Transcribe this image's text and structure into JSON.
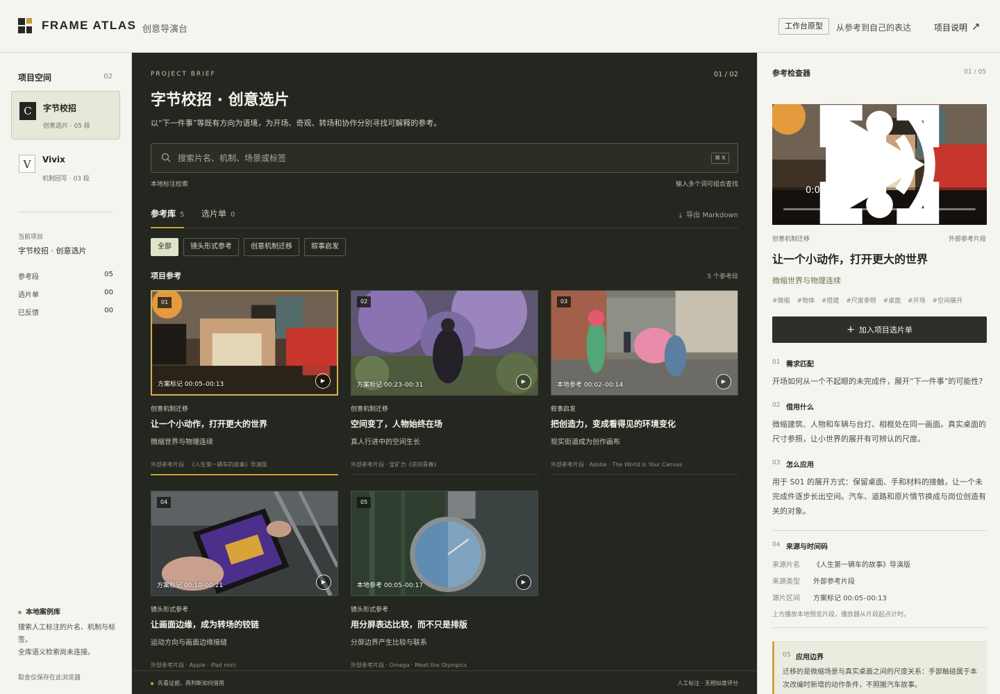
{
  "header": {
    "brand": "FRAME ATLAS",
    "subtitle": "创意导演台",
    "badge": "工作台原型",
    "tagline": "从参考到自己的表达",
    "link": "项目说明",
    "link_icon": "arrow-up-right-icon"
  },
  "sidebar": {
    "title": "项目空间",
    "count": "02",
    "projects": [
      {
        "icon": "C",
        "name": "字节校招",
        "meta": "创意选片 · 05 段"
      },
      {
        "icon": "V",
        "name": "Vivix",
        "meta": "机制回写 · 03 段"
      }
    ],
    "current_label": "当前项目",
    "current_name": "字节校招 · 创意选片",
    "stats": [
      {
        "label": "参考段",
        "value": "05"
      },
      {
        "label": "选片单",
        "value": "00"
      },
      {
        "label": "已反馈",
        "value": "00"
      }
    ],
    "local_title": "本地案例库",
    "local_desc_1": "搜索人工标注的片名、机制与标签。",
    "local_desc_2": "全库语义检索尚未连接。",
    "footer": "取舍仅保存在此浏览器"
  },
  "main": {
    "eyebrow": "PROJECT BRIEF",
    "page": "01 / 02",
    "title": "字节校招 · 创意选片",
    "desc": "以“下一件事”等既有方向为语境，为开场、奇观、转场和协作分别寻找可解释的参考。",
    "search_placeholder": "搜索片名、机制、场景或标签",
    "shortcut": "⌘ K",
    "hint_left": "本地标注检索",
    "hint_right": "输入多个词可组合查找",
    "tabs": [
      {
        "label": "参考库",
        "count": "5"
      },
      {
        "label": "选片单",
        "count": "0"
      }
    ],
    "export": "导出 Markdown",
    "filters": [
      "全部",
      "镜头形式参考",
      "创意机制迁移",
      "叙事启发"
    ],
    "section_title": "项目参考",
    "section_count": "5 个参考段",
    "cards": [
      {
        "num": "01",
        "timecode": "方案标记 00:05–00:13",
        "tag": "创意机制迁移",
        "title": "让一个小动作，打开更大的世界",
        "subtitle": "微缩世界与物理连续",
        "source": "外部参考片段 · 《人生第一辆车的故事》导演版"
      },
      {
        "num": "02",
        "timecode": "方案标记 00:23–00:31",
        "tag": "创意机制迁移",
        "title": "空间变了，人物始终在场",
        "subtitle": "真人行进中的空间生长",
        "source": "外部参考片段 · 宝矿力《逆向青春》"
      },
      {
        "num": "03",
        "timecode": "本地参考 00:02–00:14",
        "tag": "叙事启发",
        "title": "把创造力，变成看得见的环境变化",
        "subtitle": "现实街道成为创作画布",
        "source": "外部参考片段 · Adobe · The World Is Your Canvas"
      },
      {
        "num": "04",
        "timecode": "方案标记 00:10–00:21",
        "tag": "镜头形式参考",
        "title": "让画面边缘，成为转场的铰链",
        "subtitle": "运动方向与画面边缘接缝",
        "source": "外部参考片段 · Apple · iPad mini"
      },
      {
        "num": "05",
        "timecode": "本地参考 00:05–00:17",
        "tag": "镜头形式参考",
        "title": "用分屏表达比较，而不只是排版",
        "subtitle": "分屏边界产生比较与联系",
        "source": "外部参考片段 · Omega · Meet the Olympics"
      }
    ],
    "footer_left": "先看证据，再判断如何借用",
    "footer_right": "人工标注 · 无相似度评分"
  },
  "inspector": {
    "title": "参考检查器",
    "count": "01 / 05",
    "video_time": "0:00 / 0:08",
    "tag_left": "创意机制迁移",
    "tag_right": "外部参考片段",
    "heading": "让一个小动作，打开更大的世界",
    "subheading": "微缩世界与物理连续",
    "hashtags": [
      "#微缩",
      "#物体",
      "#搭建",
      "#尺度参照",
      "#桌面",
      "#开场",
      "#空间展开"
    ],
    "add_button": "加入项目选片单",
    "sections": [
      {
        "num": "01",
        "title": "需求匹配",
        "body": "开场如何从一个不起眼的未完成件，展开“下一件事”的可能性?"
      },
      {
        "num": "02",
        "title": "借用什么",
        "body": "微缩建筑、人物和车辆与台灯、相框处在同一画面。真实桌面的尺寸参照，让小世界的展开有可辨认的尺度。"
      },
      {
        "num": "03",
        "title": "怎么应用",
        "body": "用于 S01 的展开方式：保留桌面、手和材料的接触，让一个未完成件逐步长出空间。汽车、道路和原片情节换成与岗位创造有关的对象。"
      }
    ],
    "source": {
      "num": "04",
      "title": "来源与时间码",
      "rows": [
        {
          "label": "来源片名",
          "value": "《人生第一辆车的故事》导演版"
        },
        {
          "label": "来源类型",
          "value": "外部参考片段"
        },
        {
          "label": "源片区间",
          "value": "方案标记 00:05–00:13"
        }
      ],
      "note": "上方播放本地预览片段，播放器从片段起点计时。"
    },
    "boundary": {
      "num": "05",
      "title": "应用边界",
      "body": "迁移的是微缩场景与真实桌面之间的尺度关系：手部触碰属于本次改编时新增的动作条件，不照搬汽车故事。"
    }
  },
  "colors": {
    "main_bg": "#23271f",
    "accent_gold": "#c9a43a",
    "panel_bg": "#f5f4ef",
    "chip_active": "#dfe4c8"
  }
}
